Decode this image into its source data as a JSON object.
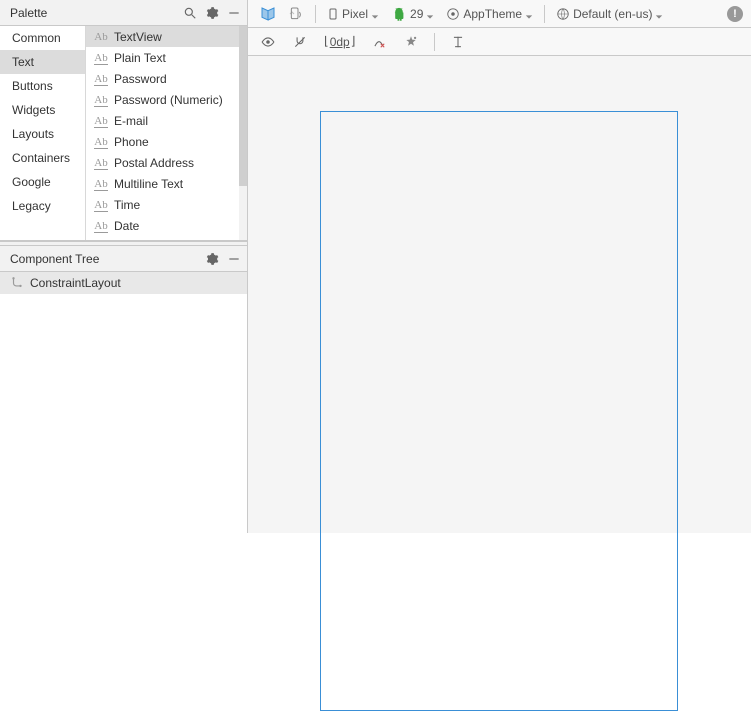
{
  "palette": {
    "title": "Palette",
    "categories": [
      "Common",
      "Text",
      "Buttons",
      "Widgets",
      "Layouts",
      "Containers",
      "Google",
      "Legacy"
    ],
    "selected_category": "Text",
    "items": [
      {
        "label": "TextView",
        "icon": "ab",
        "selected": true
      },
      {
        "label": "Plain Text",
        "icon": "abu",
        "selected": false
      },
      {
        "label": "Password",
        "icon": "abu",
        "selected": false
      },
      {
        "label": "Password (Numeric)",
        "icon": "abu",
        "selected": false
      },
      {
        "label": "E-mail",
        "icon": "abu",
        "selected": false
      },
      {
        "label": "Phone",
        "icon": "abu",
        "selected": false
      },
      {
        "label": "Postal Address",
        "icon": "abu",
        "selected": false
      },
      {
        "label": "Multiline Text",
        "icon": "abu",
        "selected": false
      },
      {
        "label": "Time",
        "icon": "abu",
        "selected": false
      },
      {
        "label": "Date",
        "icon": "abu",
        "selected": false
      }
    ]
  },
  "component_tree": {
    "title": "Component Tree",
    "root": "ConstraintLayout"
  },
  "toolbar": {
    "device": "Pixel",
    "api": "29",
    "theme_label": "AppTheme",
    "locale": "Default (en-us)"
  },
  "toolbar2": {
    "margin": "0dp"
  }
}
